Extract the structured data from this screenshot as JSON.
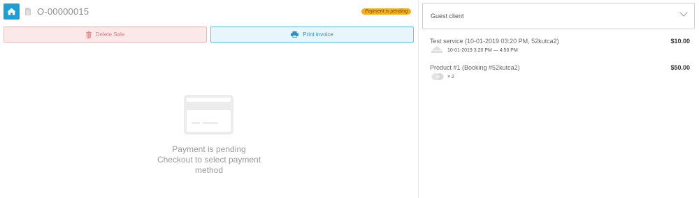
{
  "header": {
    "order_id": "O-00000015",
    "status_badge": "Payment is pending"
  },
  "actions": {
    "delete_label": "Delete Sale",
    "print_label": "Print invoice"
  },
  "payment": {
    "line1": "Payment is pending",
    "line2": "Checkout to select payment",
    "line3": "method"
  },
  "client": {
    "selected": "Guest client"
  },
  "items": [
    {
      "title": "Test service (10-01-2019 03:20 PM, 52kutca2)",
      "price": "$10.00",
      "meta": "10-01-2019 3:20 PM — 4:50 PM",
      "icon": "service-icon"
    },
    {
      "title": "Product #1 (Booking #52kutca2)",
      "price": "$50.00",
      "meta": "× 2",
      "icon": "product-icon"
    }
  ],
  "colors": {
    "home_button": "#1a9fd7",
    "badge": "#f4b01b",
    "delete": "#e07a7a",
    "print": "#2b8fbf"
  }
}
